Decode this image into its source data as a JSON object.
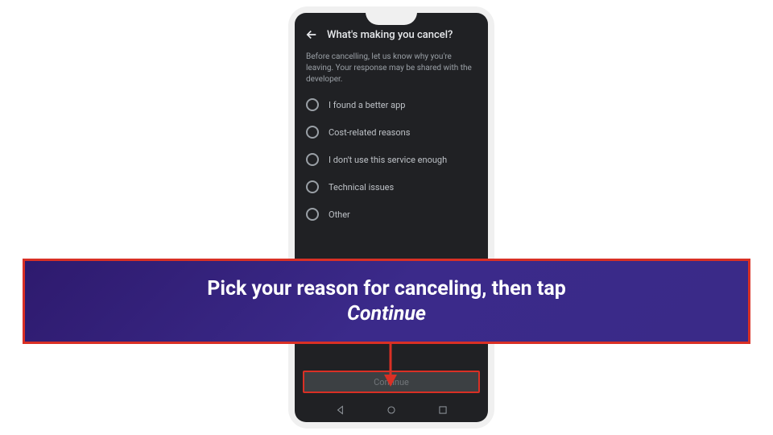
{
  "header": {
    "title": "What's making you cancel?"
  },
  "subtitle": "Before cancelling, let us know why you're leaving. Your response may be shared with the developer.",
  "options": [
    "I found a better app",
    "Cost-related reasons",
    "I don't use this service enough",
    "Technical issues",
    "Other"
  ],
  "continue_label": "Continue",
  "callout": {
    "line1": "Pick your reason for canceling, then tap",
    "line2": "Continue"
  }
}
